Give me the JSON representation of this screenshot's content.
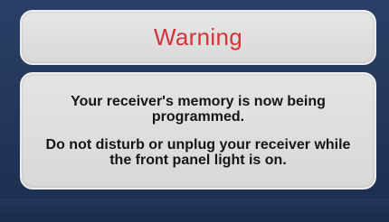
{
  "dialog": {
    "title": "Warning",
    "message_line_1": "Your receiver's memory is now being programmed.",
    "message_line_2": "Do not disturb or unplug your receiver while the front panel light is on."
  },
  "colors": {
    "background": "#223659",
    "panel": "#dedede",
    "title_text": "#d2343a",
    "message_text": "#151515"
  }
}
